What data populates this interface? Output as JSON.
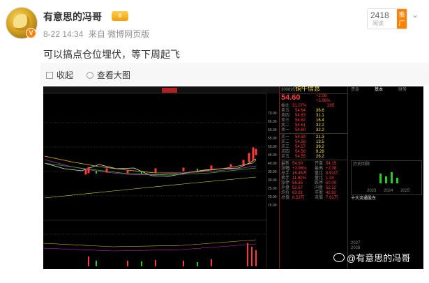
{
  "user": {
    "name": "有意思的冯哥",
    "badge_text": "II",
    "verified_letter": "V"
  },
  "post_meta": {
    "date": "8-22 14:34",
    "source": "来自 微博网页版"
  },
  "promo": {
    "count": "2418",
    "sub": "阅读",
    "tag": "推广"
  },
  "more_icon": "chevron-down-icon",
  "post": {
    "text": "可以搞点仓位埋伏，等下周起飞"
  },
  "toolbar": {
    "collapse_label": "收起",
    "view_large_label": "查看大图"
  },
  "stock": {
    "code": "300895",
    "name": "铜牛信息",
    "price": "54.60",
    "change": "+2.08",
    "change_pct": "+3.96%",
    "committee_label": "委比",
    "committee_value": "31.07%",
    "committee_diff": "285",
    "sell_rows": [
      {
        "label": "卖五",
        "price": "54.64",
        "vol": "36.6"
      },
      {
        "label": "卖四",
        "price": "54.63",
        "vol": "31.1"
      },
      {
        "label": "卖三",
        "price": "54.62",
        "vol": "16.4"
      },
      {
        "label": "卖二",
        "price": "54.61",
        "vol": "32.2"
      },
      {
        "label": "卖一",
        "price": "54.60",
        "vol": "32.2"
      }
    ],
    "buy_rows": [
      {
        "label": "买一",
        "price": "54.59",
        "vol": "21.3"
      },
      {
        "label": "买二",
        "price": "54.58",
        "vol": "13.5"
      },
      {
        "label": "买三",
        "price": "54.57",
        "vol": "39.2"
      },
      {
        "label": "买四",
        "price": "54.56",
        "vol": "9.28"
      },
      {
        "label": "买五",
        "price": "54.55",
        "vol": "26.2"
      }
    ],
    "stats": [
      {
        "k": "最新",
        "v": "54.60",
        "k2": "开盘",
        "v2": "54.15"
      },
      {
        "k": "涨幅",
        "v": "+3.96%",
        "k2": "最高",
        "v2": "+2.08"
      },
      {
        "k": "总手",
        "v": "16.45万",
        "k2": "量比",
        "v2": "8.91亿"
      },
      {
        "k": "换手",
        "v": "11.90%",
        "k2": "量比",
        "v2": "1.34"
      },
      {
        "k": "涨停",
        "v": "56.85",
        "k2": "跌停",
        "v2": "50.00"
      },
      {
        "k": "外盘",
        "v": "52.67",
        "k2": "内盘",
        "v2": "52.52"
      },
      {
        "k": "均价",
        "v": "63.81",
        "k2": "市盈",
        "v2": "42.82"
      },
      {
        "k": "总值",
        "v": "8.53万",
        "k2": "流值",
        "v2": "7.91万"
      }
    ]
  },
  "panel2": {
    "tabs": [
      "资金",
      "基本",
      "财务"
    ],
    "label_hist": "历史回顾",
    "years": [
      "2023",
      "2024",
      "2025"
    ],
    "section": "十大流通股东",
    "rows": [
      {
        "a": "2027",
        "b": "—",
        "c": "—"
      },
      {
        "a": "2026",
        "b": "—",
        "c": "—"
      }
    ]
  },
  "chart_axis": {
    "right_ticks": [
      "70.00",
      "65.00",
      "60.00",
      "55.00",
      "50.00",
      "45.00",
      "40.00",
      "35.00",
      "30.00",
      "25.00",
      "20.00",
      "15.00"
    ]
  },
  "watermark": "@有意思的冯哥",
  "colors": {
    "accent": "#ff8200",
    "up": "#ff3b3b",
    "down": "#22d022",
    "chart_bg": "#000000"
  }
}
